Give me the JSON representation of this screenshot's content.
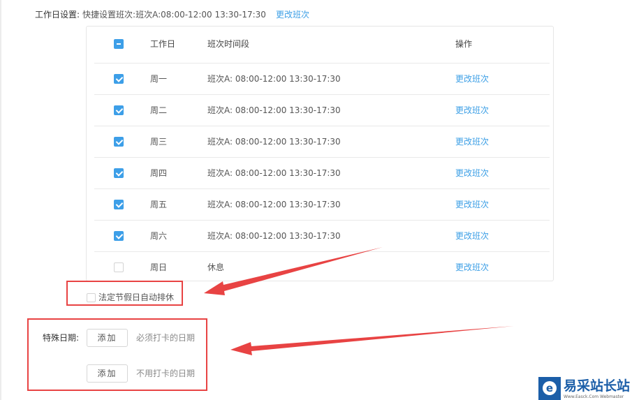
{
  "workday_setting": {
    "label": "工作日设置:",
    "quick_text": "快捷设置班次:班次A:08:00-12:00 13:30-17:30",
    "change_link": "更改班次"
  },
  "table": {
    "headers": {
      "workday": "工作日",
      "shift": "班次时间段",
      "action": "操作"
    },
    "header_checkbox_state": "indeterminate",
    "rows": [
      {
        "checked": true,
        "day": "周一",
        "shift": "班次A: 08:00-12:00 13:30-17:30",
        "action": "更改班次"
      },
      {
        "checked": true,
        "day": "周二",
        "shift": "班次A: 08:00-12:00 13:30-17:30",
        "action": "更改班次"
      },
      {
        "checked": true,
        "day": "周三",
        "shift": "班次A: 08:00-12:00 13:30-17:30",
        "action": "更改班次"
      },
      {
        "checked": true,
        "day": "周四",
        "shift": "班次A: 08:00-12:00 13:30-17:30",
        "action": "更改班次"
      },
      {
        "checked": true,
        "day": "周五",
        "shift": "班次A: 08:00-12:00 13:30-17:30",
        "action": "更改班次"
      },
      {
        "checked": true,
        "day": "周六",
        "shift": "班次A: 08:00-12:00 13:30-17:30",
        "action": "更改班次"
      },
      {
        "checked": false,
        "day": "周日",
        "shift": "休息",
        "action": "更改班次"
      }
    ]
  },
  "holiday": {
    "label": "法定节假日自动排休",
    "checked": false
  },
  "special_dates": {
    "label": "特殊日期:",
    "add_label": "添加",
    "must_clock_hint": "必须打卡的日期",
    "no_clock_hint": "不用打卡的日期"
  },
  "watermark": {
    "name": "易采站长站",
    "sub": "Www.Easck.Com Webmaster"
  },
  "colors": {
    "accent": "#3d9fe8",
    "link": "#3ea0e6",
    "annotation": "#e84343",
    "watermark": "#1b5ea8"
  }
}
